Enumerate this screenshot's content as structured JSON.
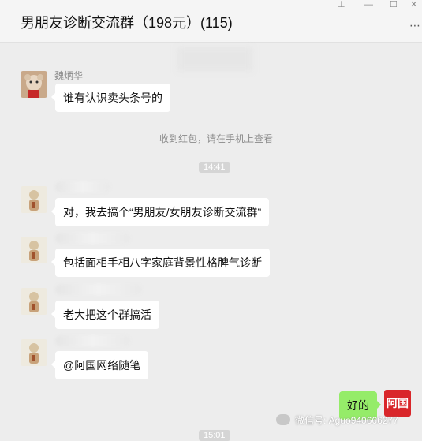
{
  "header": {
    "title": "男朋友诊断交流群（198元）(115)",
    "more_glyph": "⋯",
    "window_controls": {
      "pin": "⊥",
      "minimize": "—",
      "maximize": "☐",
      "close": "✕"
    }
  },
  "messages": [
    {
      "sender": "魏炳华",
      "text": "谁有认识卖头条号的"
    },
    {
      "system": "收到红包，请在手机上查看"
    },
    {
      "time": "14:41"
    },
    {
      "text": "对，我去搞个“男朋友/女朋友诊断交流群”"
    },
    {
      "text": "包括面相手相八字家庭背景性格脾气诊断"
    },
    {
      "text": "老大把这个群搞活"
    },
    {
      "text": "@阿国网络随笔"
    },
    {
      "text": "好的",
      "self": true,
      "avatar_text": "阿国"
    },
    {
      "time": "15:01"
    }
  ],
  "watermark": {
    "label": "微信号: Aguo940666277"
  },
  "colors": {
    "self_bubble": "#95ec69",
    "other_bubble": "#ffffff",
    "background": "#ededed",
    "self_avatar": "#d9262a"
  }
}
